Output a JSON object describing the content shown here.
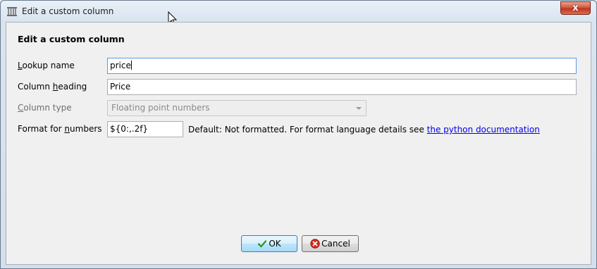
{
  "window": {
    "title": "Edit a custom column",
    "close_label": "x"
  },
  "dialog": {
    "heading": "Edit a custom column",
    "lookup_name": {
      "label_pre": "",
      "label_u": "L",
      "label_post": "ookup name",
      "value": "price"
    },
    "column_heading": {
      "label_pre": "Column ",
      "label_u": "h",
      "label_post": "eading",
      "value": "Price"
    },
    "column_type": {
      "label_pre": "",
      "label_u": "C",
      "label_post": "olumn type",
      "value": "Floating point numbers"
    },
    "format": {
      "label_pre": "Format for ",
      "label_u": "n",
      "label_post": "umbers",
      "value": "${0:,.2f}"
    },
    "help_text": "Default: Not formatted. For format language details see ",
    "help_link": "the python documentation"
  },
  "buttons": {
    "ok": "OK",
    "cancel": "Cancel"
  },
  "icons": {
    "app": "calibre-app-icon",
    "ok": "checkmark-icon",
    "cancel": "cancel-icon",
    "close": "close-icon"
  },
  "colors": {
    "link": "#0000ee",
    "close_red": "#c0341b",
    "focus_border": "#569de5"
  }
}
